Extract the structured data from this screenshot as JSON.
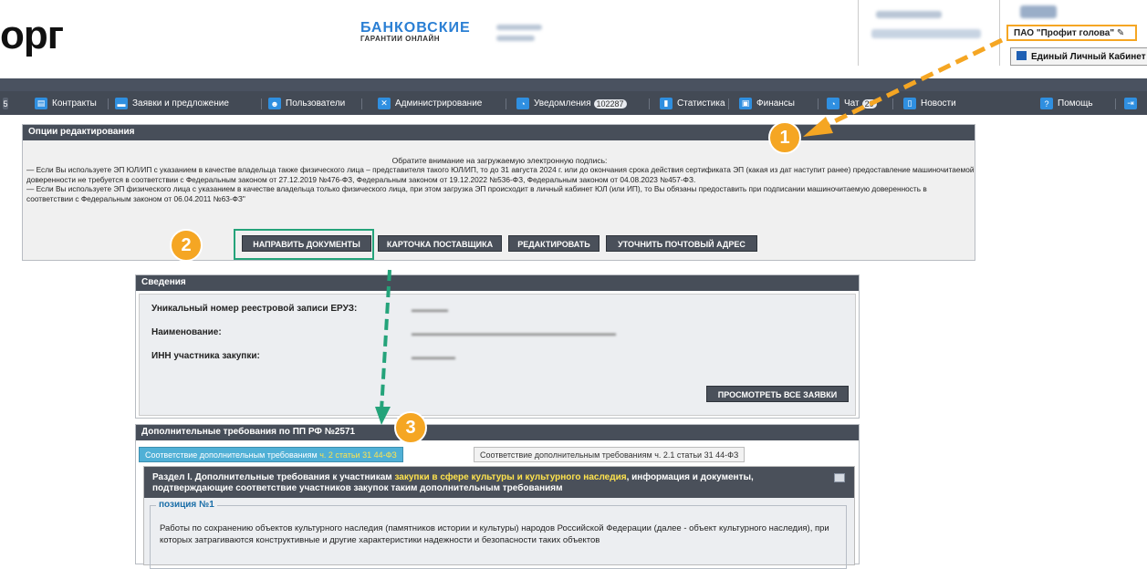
{
  "header": {
    "logo_text": "орг",
    "promo_title": "БАНКОВСКИЕ",
    "promo_subtitle": "ГАРАНТИИ ОНЛАЙН",
    "org_name": "ПАО \"Профит голова\"",
    "cabinet_label": "Единый Личный Кабинет"
  },
  "nav": {
    "items": [
      {
        "label": "Контракты",
        "icon": "contract-icon"
      },
      {
        "label": "Заявки и предложение",
        "icon": "folder-icon"
      },
      {
        "label": "Пользователи",
        "icon": "users-icon"
      },
      {
        "label": "Администрирование",
        "icon": "tools-icon"
      },
      {
        "label": "Уведомления",
        "icon": "chat-icon",
        "badge": "102287"
      },
      {
        "label": "Статистика",
        "icon": "stats-icon"
      },
      {
        "label": "Финансы",
        "icon": "finance-icon"
      },
      {
        "label": "Чат",
        "icon": "chat-icon",
        "badge": "29"
      },
      {
        "label": "Новости",
        "icon": "news-icon"
      },
      {
        "label": "Помощь",
        "icon": "help-icon"
      }
    ]
  },
  "options": {
    "title": "Опции редактирования",
    "notice_title": "Обратите внимание на загружаемую электронную подпись:",
    "notice_body": "— Если Вы используете ЭП ЮЛ/ИП с указанием в качестве владельца также физического лица – представителя такого ЮЛ/ИП, то до 31 августа 2024 г. или до окончания срока действия сертификата ЭП (какая из дат наступит ранее) предоставление машиночитаемой доверенности не требуется в соответствии с Федеральным законом от 27.12.2019 №476-ФЗ, Федеральным законом от 19.12.2022 №536-ФЗ, Федеральным законом от 04.08.2023 №457-ФЗ.\n— Если Вы используете ЭП физического лица с указанием в качестве владельца только физического лица, при этом загрузка ЭП происходит в личный кабинет ЮЛ (или ИП), то Вы обязаны предоставить при подписании машиночитаемую доверенность в соответствии с Федеральным законом от 06.04.2011 №63-ФЗ\"",
    "buttons": {
      "send_docs": "НАПРАВИТЬ ДОКУМЕНТЫ",
      "supplier_card": "КАРТОЧКА ПОСТАВЩИКА",
      "edit": "РЕДАКТИРОВАТЬ",
      "clarify_address": "УТОЧНИТЬ ПОЧТОВЫЙ АДРЕС"
    }
  },
  "info": {
    "title": "Сведения",
    "label_registry": "Уникальный номер реестровой записи ЕРУЗ:",
    "label_name": "Наименование:",
    "label_inn": "ИНН участника закупки:",
    "view_all_button": "ПРОСМОТРЕТЬ ВСЕ ЗАЯВКИ"
  },
  "requirements": {
    "title": "Дополнительные требования по ПП РФ №2571",
    "tab1_prefix": "Соответствие дополнительным требованиям ",
    "tab1_highlight": "ч. 2 статьи 31 44-ФЗ",
    "tab2_label": "Соответствие дополнительным требованиям ч. 2.1 статьи 31 44-ФЗ",
    "section_prefix": "Раздел I. Дополнительные требования к участникам ",
    "section_highlight": "закупки в сфере культуры и культурного наследия",
    "section_suffix": ", информация и документы, подтверждающие соответствие участников закупок таким дополнительным требованиям",
    "position_legend": "позиция №1",
    "position_text": "Работы по сохранению объектов культурного наследия (памятников истории и культуры) народов Российской Федерации (далее - объект культурного наследия), при которых затрагиваются конструктивные и другие характеристики надежности и безопасности таких объектов"
  },
  "annotations": {
    "step1": "1",
    "step2": "2",
    "step3": "3"
  },
  "colors": {
    "accent_orange": "#f5a623",
    "highlight_green": "#24a37a",
    "nav_bg": "#434a55"
  }
}
